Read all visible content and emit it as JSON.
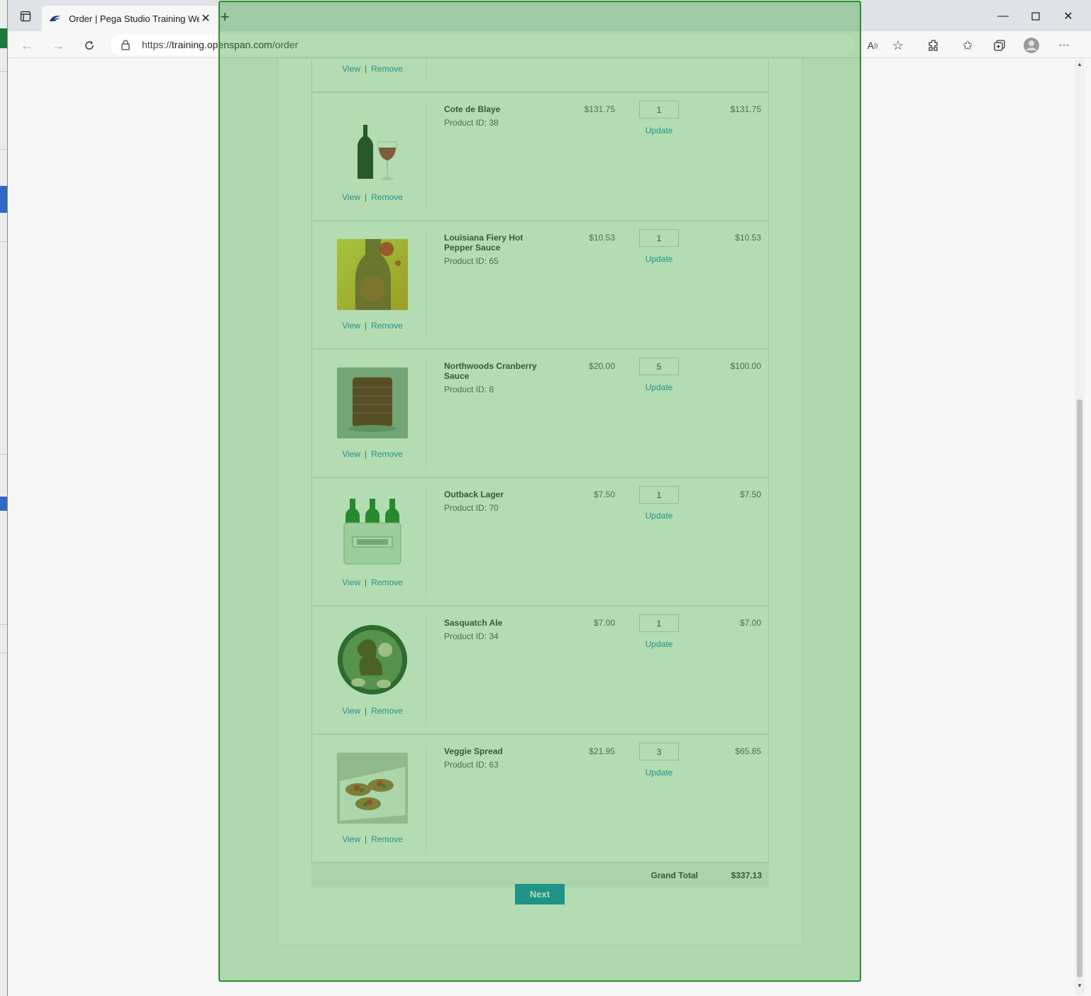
{
  "browser": {
    "tab_title": "Order | Pega Studio Training Wel",
    "new_tab": "+",
    "url_prefix": "https://",
    "url_host": "training.openspan.com",
    "url_path": "/order",
    "window_controls": {
      "minimize": "—",
      "maximize": "☐",
      "close": "✕"
    }
  },
  "cart": {
    "view_label": "View",
    "remove_label": "Remove",
    "separator": "|",
    "update_label": "Update",
    "items": [
      {
        "name": "Cote de Blaye",
        "product_id": "Product ID: 38",
        "price": "$131.75",
        "qty": "1",
        "total": "$131.75",
        "image": "wine-bottle-glass"
      },
      {
        "name": "Louisiana Fiery Hot Pepper Sauce",
        "product_id": "Product ID: 65",
        "price": "$10.53",
        "qty": "1",
        "total": "$10.53",
        "image": "hot-sauce-bottle"
      },
      {
        "name": "Northwoods Cranberry Sauce",
        "product_id": "Product ID: 8",
        "price": "$20.00",
        "qty": "5",
        "total": "$100.00",
        "image": "cranberry-can"
      },
      {
        "name": "Outback Lager",
        "product_id": "Product ID: 70",
        "price": "$7.50",
        "qty": "1",
        "total": "$7.50",
        "image": "beer-six-pack"
      },
      {
        "name": "Sasquatch Ale",
        "product_id": "Product ID: 34",
        "price": "$7.00",
        "qty": "1",
        "total": "$7.00",
        "image": "sasquatch-label"
      },
      {
        "name": "Veggie Spread",
        "product_id": "Product ID: 63",
        "price": "$21.95",
        "qty": "3",
        "total": "$65.85",
        "image": "veggie-crostini"
      }
    ],
    "grand_total_label": "Grand Total",
    "grand_total": "$337.13",
    "next_label": "Next"
  },
  "colors": {
    "link": "#1c89b8",
    "button": "#118ab8",
    "overlay": "#38a338"
  }
}
